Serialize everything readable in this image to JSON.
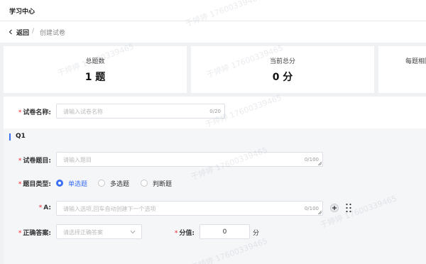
{
  "app": {
    "title": "学习中心"
  },
  "breadcrumb": {
    "back": "返回",
    "separator": "/",
    "current": "创建试卷"
  },
  "stats": [
    {
      "label": "总题数",
      "value": "1 题"
    },
    {
      "label": "当前总分",
      "value": "0 分"
    },
    {
      "label": "每题相同"
    }
  ],
  "form": {
    "paper_name": {
      "label": "试卷名称:",
      "placeholder": "请输入试卷名称",
      "count": "0/20"
    }
  },
  "question": {
    "title": "Q1",
    "topic": {
      "label": "试卷题目:",
      "placeholder": "请输入题目",
      "count": "0/100"
    },
    "type": {
      "label": "题目类型:",
      "options": [
        "单选题",
        "多选题",
        "判断题"
      ],
      "selected": "单选题"
    },
    "option_a": {
      "label": "A:",
      "placeholder": "请输入选项,回车自动创建下一个选项",
      "count": "0/100"
    },
    "answer": {
      "label": "正确答案:",
      "placeholder": "请选择正确答案"
    },
    "score": {
      "label": "分值:",
      "value": "0",
      "unit": "分"
    }
  },
  "watermark": "于婷婷 17600339465",
  "colors": {
    "accent": "#3b6ff5",
    "required": "#f5222d"
  },
  "icons": [
    "chevron-left-icon",
    "plus-icon",
    "drag-handle-icon",
    "chevron-down-icon"
  ]
}
